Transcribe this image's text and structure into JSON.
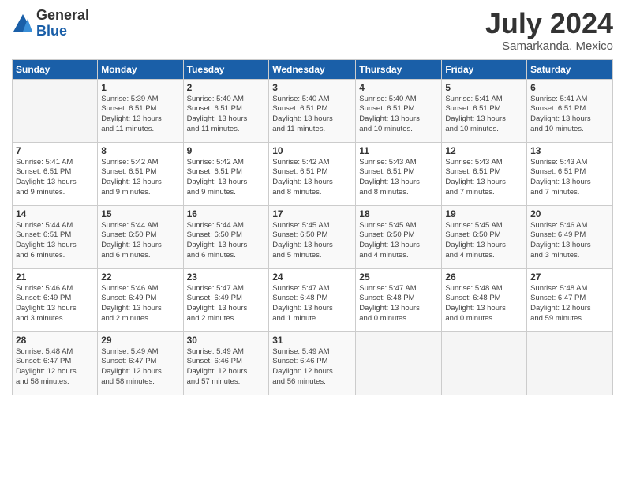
{
  "logo": {
    "general": "General",
    "blue": "Blue"
  },
  "title": "July 2024",
  "subtitle": "Samarkanda, Mexico",
  "days_of_week": [
    "Sunday",
    "Monday",
    "Tuesday",
    "Wednesday",
    "Thursday",
    "Friday",
    "Saturday"
  ],
  "weeks": [
    [
      {
        "num": "",
        "info": ""
      },
      {
        "num": "1",
        "info": "Sunrise: 5:39 AM\nSunset: 6:51 PM\nDaylight: 13 hours\nand 11 minutes."
      },
      {
        "num": "2",
        "info": "Sunrise: 5:40 AM\nSunset: 6:51 PM\nDaylight: 13 hours\nand 11 minutes."
      },
      {
        "num": "3",
        "info": "Sunrise: 5:40 AM\nSunset: 6:51 PM\nDaylight: 13 hours\nand 11 minutes."
      },
      {
        "num": "4",
        "info": "Sunrise: 5:40 AM\nSunset: 6:51 PM\nDaylight: 13 hours\nand 10 minutes."
      },
      {
        "num": "5",
        "info": "Sunrise: 5:41 AM\nSunset: 6:51 PM\nDaylight: 13 hours\nand 10 minutes."
      },
      {
        "num": "6",
        "info": "Sunrise: 5:41 AM\nSunset: 6:51 PM\nDaylight: 13 hours\nand 10 minutes."
      }
    ],
    [
      {
        "num": "7",
        "info": "Sunrise: 5:41 AM\nSunset: 6:51 PM\nDaylight: 13 hours\nand 9 minutes."
      },
      {
        "num": "8",
        "info": "Sunrise: 5:42 AM\nSunset: 6:51 PM\nDaylight: 13 hours\nand 9 minutes."
      },
      {
        "num": "9",
        "info": "Sunrise: 5:42 AM\nSunset: 6:51 PM\nDaylight: 13 hours\nand 9 minutes."
      },
      {
        "num": "10",
        "info": "Sunrise: 5:42 AM\nSunset: 6:51 PM\nDaylight: 13 hours\nand 8 minutes."
      },
      {
        "num": "11",
        "info": "Sunrise: 5:43 AM\nSunset: 6:51 PM\nDaylight: 13 hours\nand 8 minutes."
      },
      {
        "num": "12",
        "info": "Sunrise: 5:43 AM\nSunset: 6:51 PM\nDaylight: 13 hours\nand 7 minutes."
      },
      {
        "num": "13",
        "info": "Sunrise: 5:43 AM\nSunset: 6:51 PM\nDaylight: 13 hours\nand 7 minutes."
      }
    ],
    [
      {
        "num": "14",
        "info": "Sunrise: 5:44 AM\nSunset: 6:51 PM\nDaylight: 13 hours\nand 6 minutes."
      },
      {
        "num": "15",
        "info": "Sunrise: 5:44 AM\nSunset: 6:50 PM\nDaylight: 13 hours\nand 6 minutes."
      },
      {
        "num": "16",
        "info": "Sunrise: 5:44 AM\nSunset: 6:50 PM\nDaylight: 13 hours\nand 6 minutes."
      },
      {
        "num": "17",
        "info": "Sunrise: 5:45 AM\nSunset: 6:50 PM\nDaylight: 13 hours\nand 5 minutes."
      },
      {
        "num": "18",
        "info": "Sunrise: 5:45 AM\nSunset: 6:50 PM\nDaylight: 13 hours\nand 4 minutes."
      },
      {
        "num": "19",
        "info": "Sunrise: 5:45 AM\nSunset: 6:50 PM\nDaylight: 13 hours\nand 4 minutes."
      },
      {
        "num": "20",
        "info": "Sunrise: 5:46 AM\nSunset: 6:49 PM\nDaylight: 13 hours\nand 3 minutes."
      }
    ],
    [
      {
        "num": "21",
        "info": "Sunrise: 5:46 AM\nSunset: 6:49 PM\nDaylight: 13 hours\nand 3 minutes."
      },
      {
        "num": "22",
        "info": "Sunrise: 5:46 AM\nSunset: 6:49 PM\nDaylight: 13 hours\nand 2 minutes."
      },
      {
        "num": "23",
        "info": "Sunrise: 5:47 AM\nSunset: 6:49 PM\nDaylight: 13 hours\nand 2 minutes."
      },
      {
        "num": "24",
        "info": "Sunrise: 5:47 AM\nSunset: 6:48 PM\nDaylight: 13 hours\nand 1 minute."
      },
      {
        "num": "25",
        "info": "Sunrise: 5:47 AM\nSunset: 6:48 PM\nDaylight: 13 hours\nand 0 minutes."
      },
      {
        "num": "26",
        "info": "Sunrise: 5:48 AM\nSunset: 6:48 PM\nDaylight: 13 hours\nand 0 minutes."
      },
      {
        "num": "27",
        "info": "Sunrise: 5:48 AM\nSunset: 6:47 PM\nDaylight: 12 hours\nand 59 minutes."
      }
    ],
    [
      {
        "num": "28",
        "info": "Sunrise: 5:48 AM\nSunset: 6:47 PM\nDaylight: 12 hours\nand 58 minutes."
      },
      {
        "num": "29",
        "info": "Sunrise: 5:49 AM\nSunset: 6:47 PM\nDaylight: 12 hours\nand 58 minutes."
      },
      {
        "num": "30",
        "info": "Sunrise: 5:49 AM\nSunset: 6:46 PM\nDaylight: 12 hours\nand 57 minutes."
      },
      {
        "num": "31",
        "info": "Sunrise: 5:49 AM\nSunset: 6:46 PM\nDaylight: 12 hours\nand 56 minutes."
      },
      {
        "num": "",
        "info": ""
      },
      {
        "num": "",
        "info": ""
      },
      {
        "num": "",
        "info": ""
      }
    ]
  ]
}
